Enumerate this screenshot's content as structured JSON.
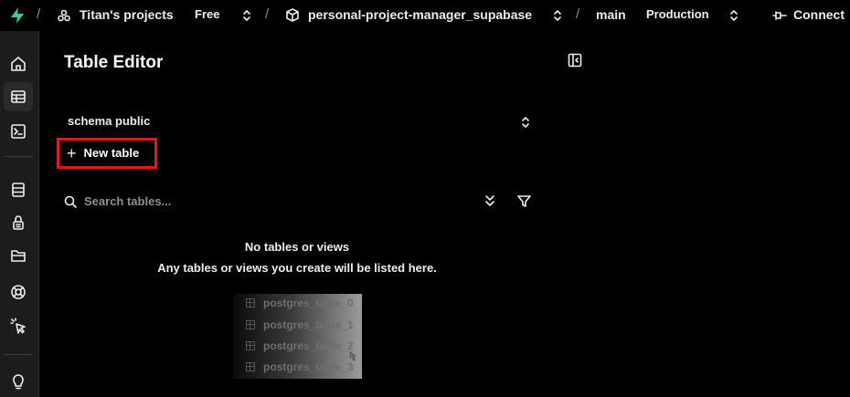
{
  "topbar": {
    "org_name": "Titan's projects",
    "plan": "Free",
    "project_name": "personal-project-manager_supabase",
    "branch": "main",
    "environment": "Production",
    "connect_label": "Connect",
    "separator": "/"
  },
  "page": {
    "title": "Table Editor"
  },
  "schema": {
    "label": "schema public"
  },
  "new_table": {
    "label": "New table"
  },
  "search": {
    "placeholder": "Search tables..."
  },
  "empty_state": {
    "title": "No tables or views",
    "subtitle": "Any tables or views you create will be listed here."
  },
  "preview_tables": [
    "postgres_table_0",
    "postgres_table_1",
    "postgres_table_2",
    "postgres_table_3"
  ],
  "colors": {
    "highlight": "#e01a1a",
    "brand": "#3ecf8e",
    "background": "#000000",
    "rail": "#1c1c1c"
  },
  "icons": {
    "rail": [
      "home-icon",
      "table-editor-icon",
      "sql-editor-icon",
      "database-icon",
      "auth-icon",
      "storage-icon",
      "realtime-icon",
      "pointer-icon",
      "advisor-icon"
    ]
  }
}
